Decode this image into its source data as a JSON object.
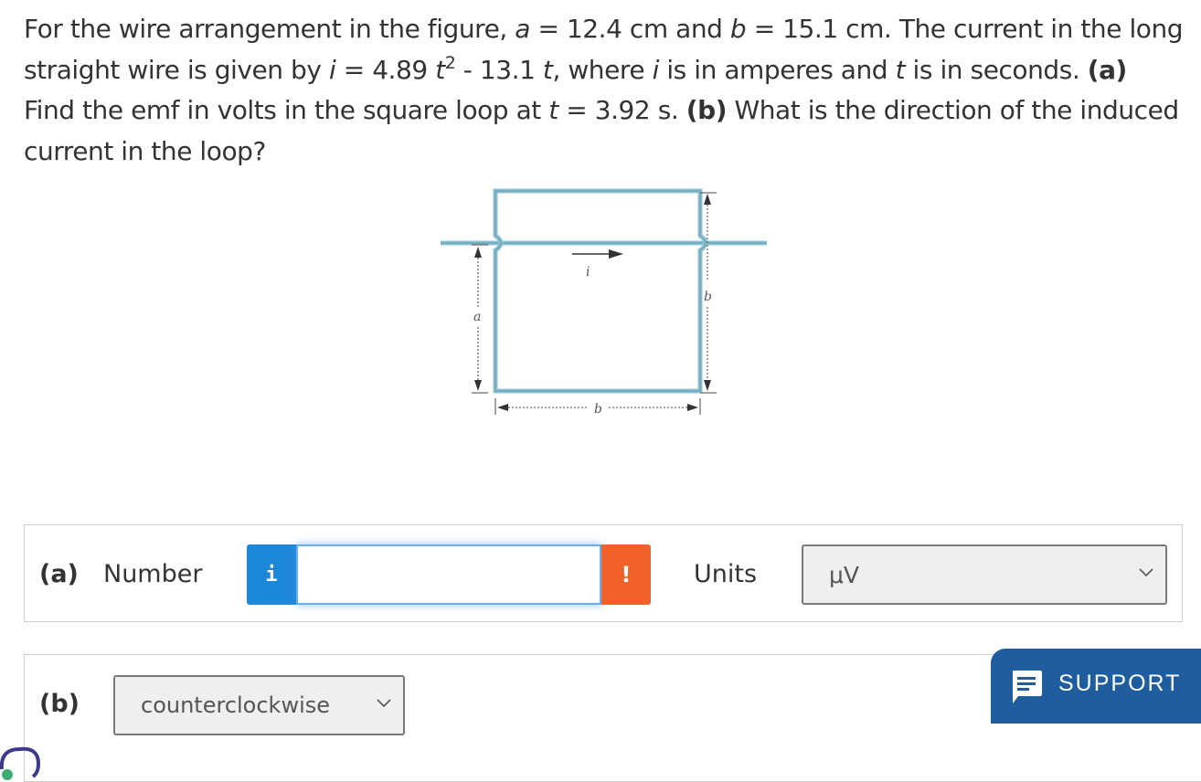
{
  "question": {
    "t1": "For the wire arrangement in the figure, ",
    "var_a": "a",
    "t2": " = 12.4 cm and ",
    "var_b": "b",
    "t3": " = 15.1 cm. The current in the long straight wire is given by ",
    "var_i": "i",
    "t4": " = 4.89 ",
    "var_t1": "t",
    "sup2": "2",
    "t5": " - 13.1 ",
    "var_t2": "t",
    "t6": ", where ",
    "var_i2": "i",
    "t7": " is in amperes and ",
    "var_t3": "t",
    "t8": " is in seconds. ",
    "part_a_tag": "(a)",
    "t9": " Find the emf in volts in the square loop at ",
    "var_t4": "t",
    "t10": " = 3.92 s. ",
    "part_b_tag": "(b)",
    "t11": " What is the direction of the induced current in the loop?"
  },
  "figure": {
    "label_a": "a",
    "label_b_right": "b",
    "label_b_bottom": "b",
    "label_i": "i"
  },
  "part_a": {
    "tag": "(a)",
    "number_label": "Number",
    "info_icon_text": "i",
    "number_value": "",
    "warning_icon_text": "!",
    "units_label": "Units",
    "units_selected": "μV"
  },
  "part_b": {
    "tag": "(b)",
    "direction_selected": "counterclockwise"
  },
  "support": {
    "label": "SUPPORT"
  },
  "colors": {
    "info_blue": "#1e88d8",
    "warning_orange": "#f0622a",
    "support_blue": "#1f5d9e",
    "wire_blue": "#8fc3d4"
  }
}
